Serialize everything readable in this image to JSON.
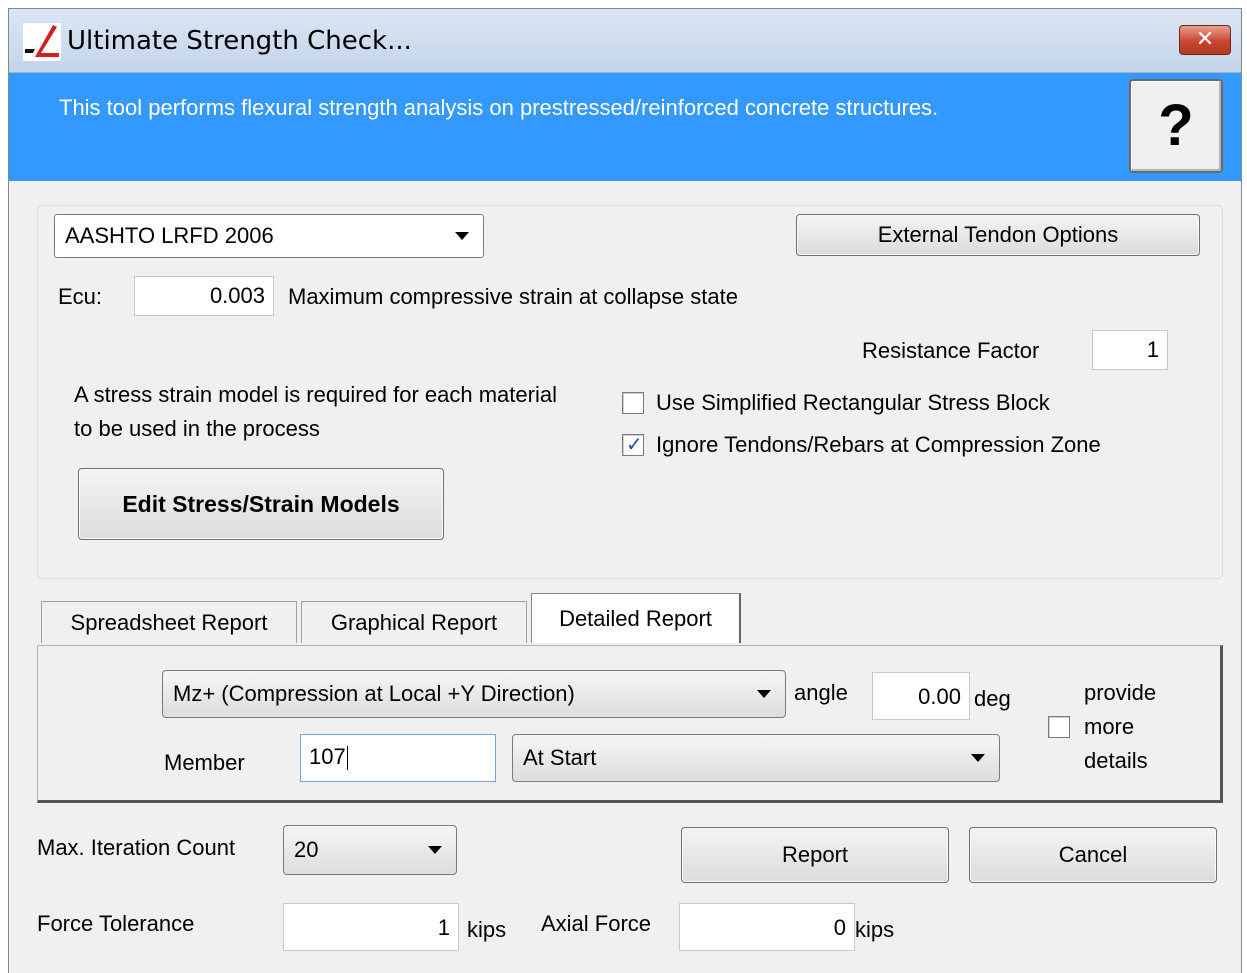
{
  "window": {
    "title": "Ultimate Strength Check...",
    "close_label": "✕"
  },
  "banner": {
    "description": "This tool performs flexural strength analysis on prestressed/reinforced concrete structures.",
    "help_label": "?"
  },
  "design_code": {
    "selected": "AASHTO LRFD 2006"
  },
  "external_tendon_button": "External Tendon Options",
  "ecu": {
    "label": "Ecu:",
    "value": "0.003",
    "description": "Maximum compressive strain at collapse state"
  },
  "resistance_factor": {
    "label": "Resistance Factor",
    "value": "1"
  },
  "stress_strain_note": "A stress strain model is required for each material to be used in the process",
  "options": {
    "simplified_block": {
      "label": "Use Simplified Rectangular Stress Block",
      "checked": false
    },
    "ignore_tendons": {
      "label": "Ignore Tendons/Rebars at Compression Zone",
      "checked": true
    }
  },
  "edit_models_button": "Edit Stress/Strain Models",
  "tabs": [
    {
      "label": "Spreadsheet Report",
      "active": false
    },
    {
      "label": "Graphical Report",
      "active": false
    },
    {
      "label": "Detailed Report",
      "active": true
    }
  ],
  "detailed": {
    "direction": {
      "selected": "Mz+ (Compression at Local +Y Direction)"
    },
    "angle_label": "angle",
    "angle_value": "0.00",
    "angle_unit": "deg",
    "member_label": "Member",
    "member_value": "107",
    "position": {
      "selected": "At Start"
    },
    "more_details_label_1": "provide",
    "more_details_label_2": "more",
    "more_details_label_3": "details",
    "more_details_checked": false
  },
  "iteration": {
    "label": "Max. Iteration Count",
    "selected": "20"
  },
  "force_tolerance": {
    "label": "Force Tolerance",
    "value": "1",
    "unit": "kips"
  },
  "axial_force": {
    "label": "Axial Force",
    "value": "0",
    "unit": "kips"
  },
  "report_button": "Report",
  "cancel_button": "Cancel"
}
